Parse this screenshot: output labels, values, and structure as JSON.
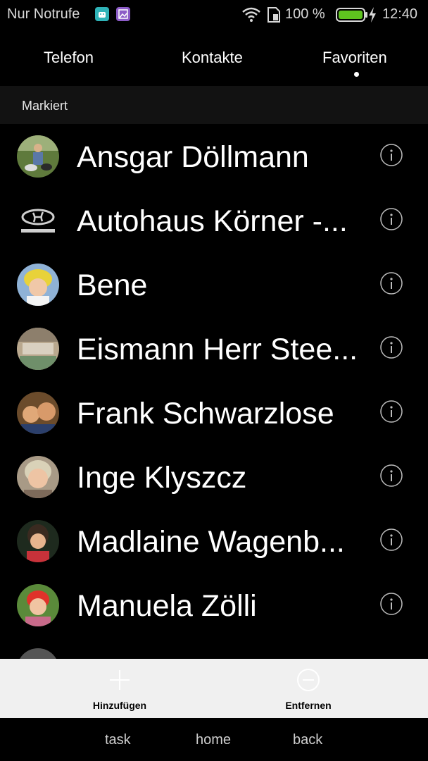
{
  "status_bar": {
    "carrier": "Nur Notrufe",
    "battery_percent_text": "100 %",
    "time": "12:40",
    "icons": [
      "android-icon",
      "gallery-icon",
      "wifi-icon",
      "sim-icon",
      "battery-icon",
      "charging-icon"
    ],
    "battery_level": 1.0,
    "battery_color": "#5fc41f"
  },
  "tabs": [
    {
      "label": "Telefon"
    },
    {
      "label": "Kontakte"
    },
    {
      "label": "Favoriten",
      "selected": true
    }
  ],
  "section": {
    "label": "Markiert"
  },
  "contacts": [
    {
      "name": "Ansgar Döllmann",
      "avatar": "photo"
    },
    {
      "name": "Autohaus Körner -...",
      "avatar": "hyundai-logo"
    },
    {
      "name": "Bene",
      "avatar": "photo"
    },
    {
      "name": "Eismann Herr Stee...",
      "avatar": "photo"
    },
    {
      "name": "Frank Schwarzlose",
      "avatar": "photo"
    },
    {
      "name": "Inge Klyszcz",
      "avatar": "photo"
    },
    {
      "name": "Madlaine Wagenb...",
      "avatar": "photo"
    },
    {
      "name": "Manuela Zölli",
      "avatar": "photo"
    }
  ],
  "actions": {
    "add_label": "Hinzufügen",
    "remove_label": "Entfernen"
  },
  "navbar": {
    "task": "task",
    "home": "home",
    "back": "back"
  },
  "colors": {
    "background": "#000000",
    "section_bg": "#121212",
    "actionbar_bg": "#f0f0f0",
    "accent_battery": "#5fc41f"
  }
}
